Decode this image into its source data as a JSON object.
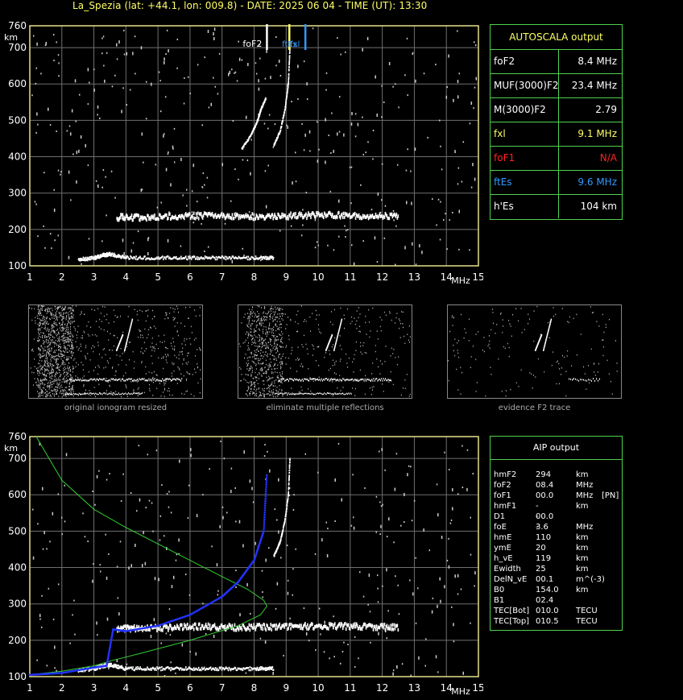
{
  "header": {
    "title": "La_Spezia (lat: +44.1, lon: 009.8) - DATE: 2025 06 04 - TIME (UT): 13:30"
  },
  "colors": {
    "axis": "#e6e08a",
    "grid": "#6f6f6f",
    "panel_border": "#4fd14f",
    "yellow": "#ffff66",
    "blue": "#3399ff",
    "red": "#ff2222",
    "profile": "#33cc33",
    "trace": "#2233ff"
  },
  "units": {
    "km": "km",
    "mhz": "MHz"
  },
  "markers": {
    "foF2": "foF2",
    "ftEs_short": "ftEs",
    "fxl": "fxl"
  },
  "autoscala": {
    "title": "AUTOSCALA output",
    "rows": [
      {
        "label": "foF2",
        "value": "8.4 MHz",
        "color": "#ffffff"
      },
      {
        "label": "MUF(3000)F2",
        "value": "23.4 MHz",
        "color": "#ffffff"
      },
      {
        "label": "M(3000)F2",
        "value": "2.79",
        "color": "#ffffff"
      },
      {
        "label": "fxl",
        "value": "9.1 MHz",
        "color": "#ffff66"
      },
      {
        "label": "foF1",
        "value": "N/A",
        "color": "#ff2222"
      },
      {
        "label": "ftEs",
        "value": "9.6 MHz",
        "color": "#3399ff"
      },
      {
        "label": "h'Es",
        "value": "104     km",
        "color": "#ffffff"
      }
    ]
  },
  "thumbnails": [
    {
      "caption": "original ionogram resized"
    },
    {
      "caption": "eliminate multiple reflections"
    },
    {
      "caption": "evidence F2 trace"
    }
  ],
  "aip": {
    "title": "AIP output",
    "rows": [
      {
        "name": "hmF2",
        "value": "294",
        "unit": "km",
        "extra": ""
      },
      {
        "name": "foF2",
        "value": "08.4",
        "unit": "MHz",
        "extra": ""
      },
      {
        "name": "foF1",
        "value": "00.0",
        "unit": "MHz",
        "extra": "[PN]"
      },
      {
        "name": "hmF1",
        "value": "---",
        "unit": "km",
        "extra": ""
      },
      {
        "name": "D1",
        "value": "00.0",
        "unit": "",
        "extra": ""
      },
      {
        "name": "foE",
        "value": "3.6",
        "unit": "MHz",
        "extra": ""
      },
      {
        "name": "hmE",
        "value": "110",
        "unit": "km",
        "extra": ""
      },
      {
        "name": "ymE",
        "value": "20",
        "unit": "km",
        "extra": ""
      },
      {
        "name": "h_vE",
        "value": "119",
        "unit": "km",
        "extra": ""
      },
      {
        "name": "Ewidth",
        "value": "25",
        "unit": "km",
        "extra": ""
      },
      {
        "name": "DelN_vE",
        "value": "00.1",
        "unit": "m^(-3)",
        "extra": ""
      },
      {
        "name": "B0",
        "value": "154.0",
        "unit": "km",
        "extra": ""
      },
      {
        "name": "B1",
        "value": "02.4",
        "unit": "",
        "extra": ""
      },
      {
        "name": "TEC[Bot]",
        "value": "010.0",
        "unit": "TECU",
        "extra": ""
      },
      {
        "name": "TEC[Top]",
        "value": "010.5",
        "unit": "TECU",
        "extra": ""
      }
    ]
  },
  "chart_data": [
    {
      "type": "scatter",
      "title": "",
      "xlabel": "MHz",
      "ylabel": "km",
      "xlim": [
        1,
        15
      ],
      "ylim": [
        100,
        760
      ],
      "xticks": [
        1,
        2,
        3,
        4,
        5,
        6,
        7,
        8,
        9,
        10,
        11,
        12,
        13,
        14,
        15
      ],
      "yticks": [
        100,
        200,
        300,
        400,
        500,
        600,
        700,
        760
      ],
      "grid": true,
      "traces": {
        "E": {
          "x": [
            2.5,
            3.0,
            3.3,
            3.5,
            4.0,
            5.0,
            6.0,
            7.0,
            8.0,
            8.6
          ],
          "y": [
            115,
            120,
            128,
            130,
            120,
            120,
            120,
            120,
            120,
            120
          ]
        },
        "Es": {
          "x": [
            3.7,
            4.5,
            5.5,
            6.5,
            7.5,
            8.5,
            9.5,
            10.5,
            11.5,
            12.5
          ],
          "y": [
            230,
            230,
            232,
            235,
            232,
            233,
            235,
            236,
            234,
            232
          ]
        },
        "F2_o": {
          "x": [
            8.6,
            8.8,
            8.95,
            9.05,
            9.1
          ],
          "y": [
            430,
            470,
            530,
            600,
            700
          ]
        },
        "F2_x": {
          "x": [
            7.6,
            7.9,
            8.1,
            8.2,
            8.35
          ],
          "y": [
            420,
            460,
            500,
            530,
            560
          ]
        }
      },
      "markers": [
        {
          "label": "foF2",
          "x": 8.4,
          "color": "#ffffff"
        },
        {
          "label": "fxl",
          "x": 9.1,
          "color": "#ffff66"
        },
        {
          "label": "ftEs",
          "x": 9.6,
          "color": "#3399ff"
        }
      ]
    },
    {
      "type": "line",
      "title": "",
      "xlabel": "MHz",
      "ylabel": "km",
      "xlim": [
        1,
        15
      ],
      "ylim": [
        100,
        760
      ],
      "xticks": [
        1,
        2,
        3,
        4,
        5,
        6,
        7,
        8,
        9,
        10,
        11,
        12,
        13,
        14,
        15
      ],
      "yticks": [
        100,
        200,
        300,
        400,
        500,
        600,
        700,
        760
      ],
      "grid": true,
      "series": [
        {
          "x": [
            1.2,
            2.0,
            3.0,
            4.0,
            5.0,
            6.0,
            7.0,
            7.8,
            8.3,
            8.4,
            8.2,
            7.5,
            6.0,
            4.5,
            3.6,
            3.0,
            2.0,
            1.0
          ],
          "y": [
            760,
            640,
            560,
            510,
            465,
            420,
            375,
            340,
            310,
            294,
            270,
            240,
            200,
            165,
            145,
            130,
            115,
            105
          ]
        },
        {
          "x": [
            1.0,
            2.0,
            3.0,
            3.4,
            3.6,
            4.0,
            5.0,
            6.0,
            7.0,
            7.5,
            8.0,
            8.3,
            8.4
          ],
          "y": [
            105,
            110,
            125,
            130,
            230,
            225,
            240,
            270,
            320,
            360,
            420,
            500,
            660
          ]
        }
      ]
    }
  ]
}
